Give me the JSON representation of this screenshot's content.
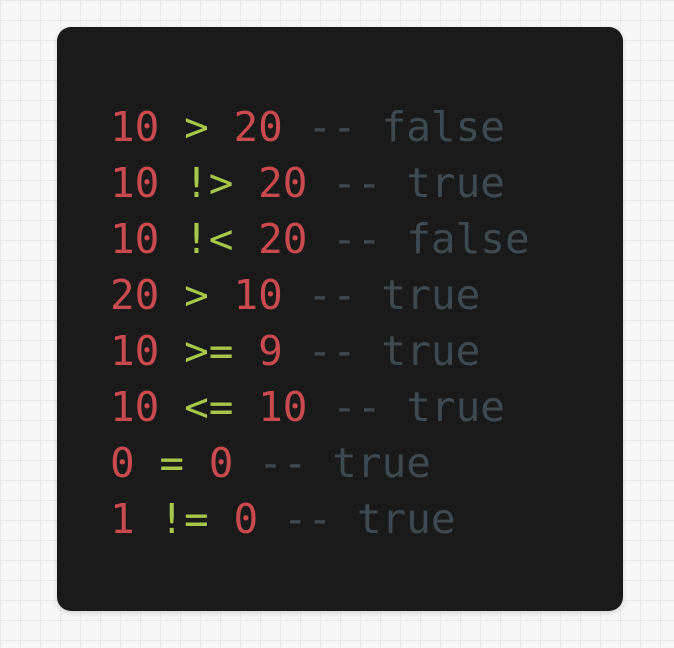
{
  "colors": {
    "number": "#c94a4f",
    "operator": "#a6c84a",
    "comment": "#3e4a52",
    "card_background": "#1a1a1a",
    "page_background": "#f7f7f7"
  },
  "code": {
    "lines": [
      {
        "left": "10",
        "operator": ">",
        "right": "20",
        "comment": "-- false"
      },
      {
        "left": "10",
        "operator": "!>",
        "right": "20",
        "comment": "-- true"
      },
      {
        "left": "10",
        "operator": "!<",
        "right": "20",
        "comment": "-- false"
      },
      {
        "left": "20",
        "operator": ">",
        "right": "10",
        "comment": "-- true"
      },
      {
        "left": "10",
        "operator": ">=",
        "right": "9",
        "comment": "-- true"
      },
      {
        "left": "10",
        "operator": "<=",
        "right": "10",
        "comment": "-- true"
      },
      {
        "left": "0",
        "operator": "=",
        "right": "0",
        "comment": "-- true"
      },
      {
        "left": "1",
        "operator": "!=",
        "right": "0",
        "comment": "-- true"
      }
    ]
  }
}
